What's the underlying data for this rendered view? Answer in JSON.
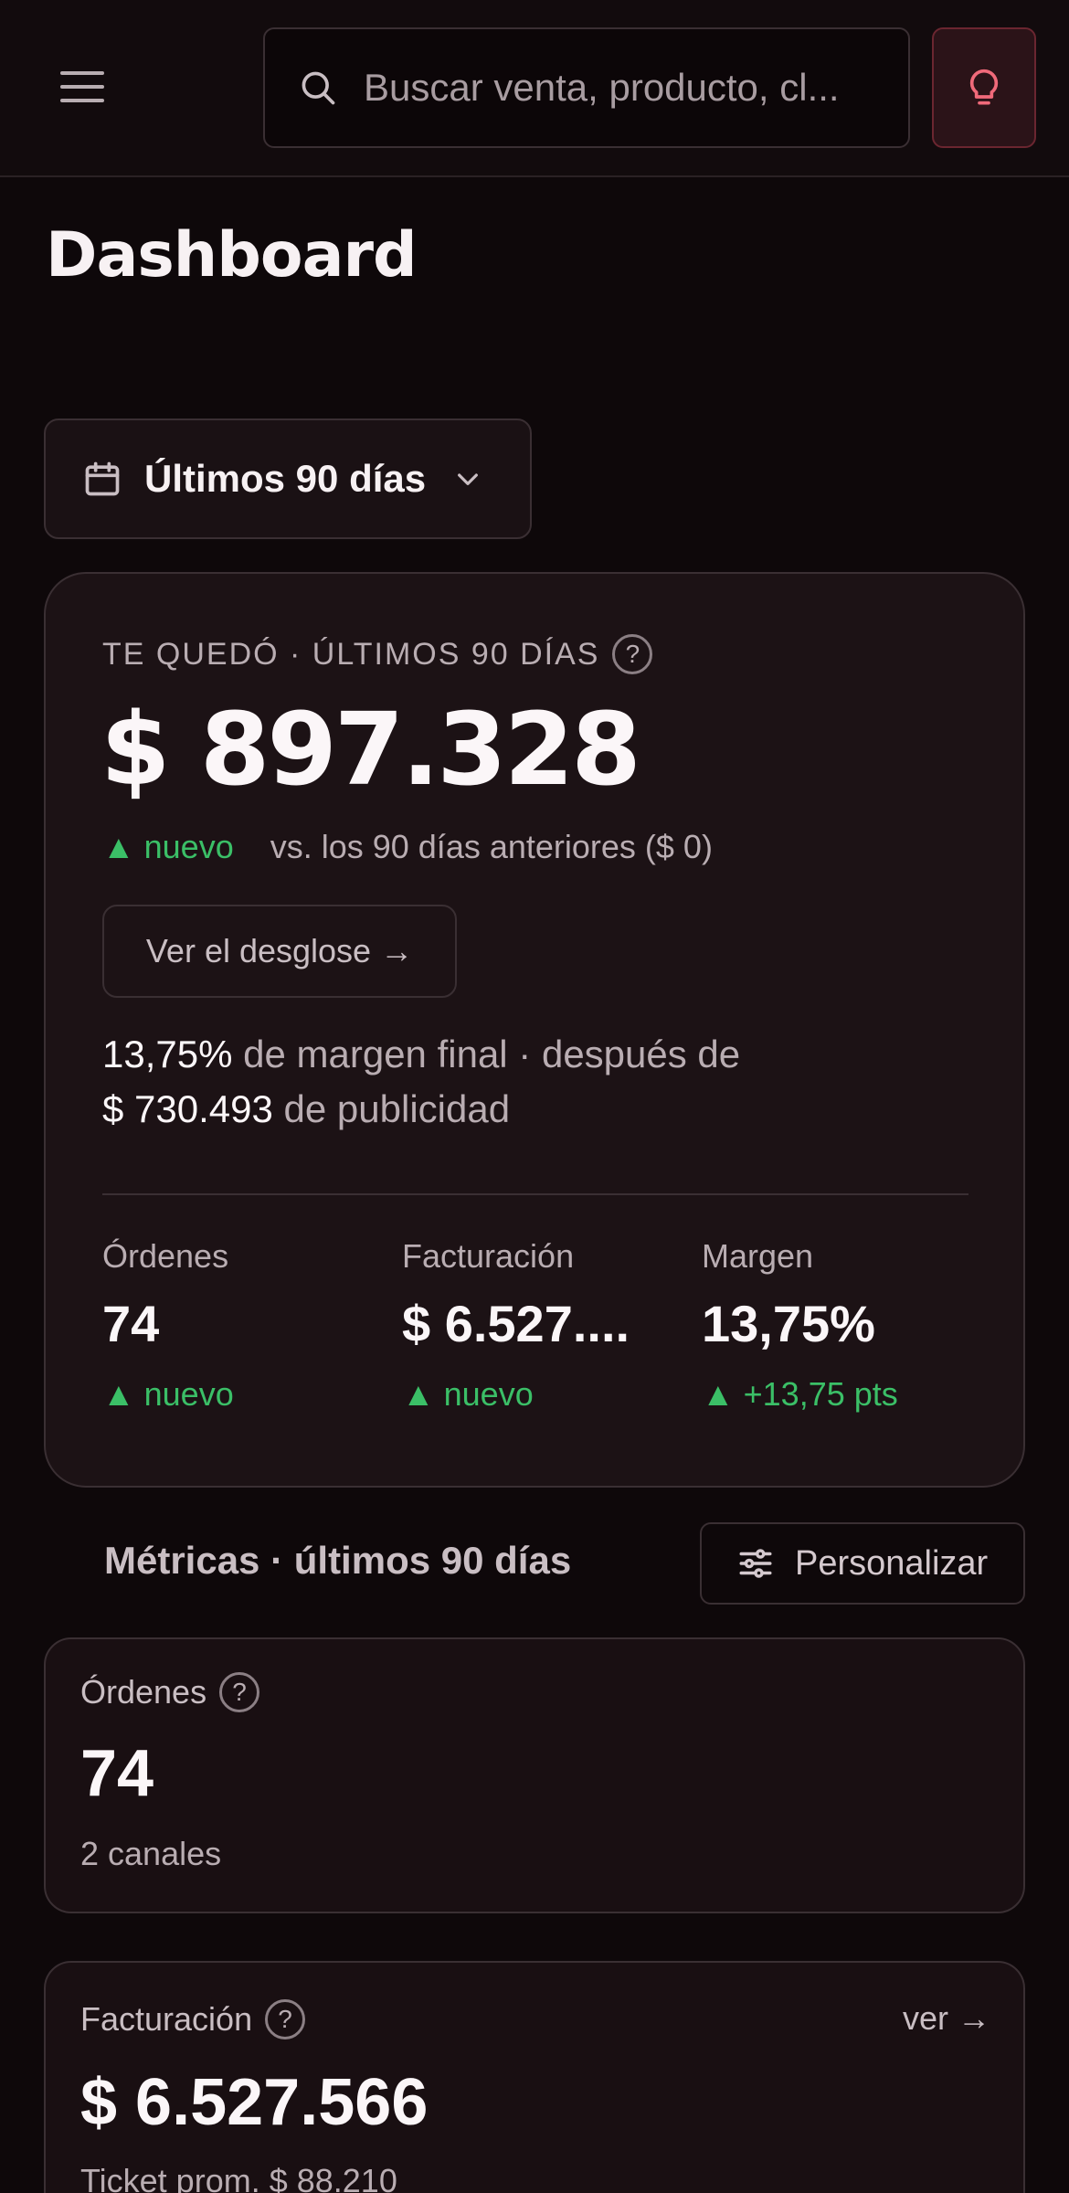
{
  "header": {
    "search_placeholder": "Buscar venta, producto, cl..."
  },
  "page_title": "Dashboard",
  "date_range": {
    "label": "Últimos 90 días"
  },
  "hero": {
    "eyebrow": "TE QUEDÓ · ÚLTIMOS 90 DÍAS",
    "help": "?",
    "value": "$ 897.328",
    "delta": "▲ nuevo",
    "compare": "vs. los 90 días anteriores ($ 0)",
    "breakdown_button": "Ver el desglose →",
    "margin_value": "13,75%",
    "margin_text": "de margen final · después de",
    "ads_value": "$ 730.493",
    "ads_text": "de publicidad",
    "kpis": [
      {
        "label": "Órdenes",
        "value": "74",
        "delta": "▲ nuevo"
      },
      {
        "label": "Facturación",
        "value": "$ 6.527....",
        "delta": "▲ nuevo"
      },
      {
        "label": "Margen",
        "value": "13,75%",
        "delta": "▲ +13,75 pts"
      }
    ]
  },
  "metrics_section": {
    "title": "Métricas · últimos 90 días",
    "customize_button": "Personalizar"
  },
  "metric_cards": [
    {
      "label": "Órdenes",
      "help": "?",
      "value": "74",
      "sub": "2 canales"
    },
    {
      "label": "Facturación",
      "help": "?",
      "value": "$ 6.527.566",
      "sub": "Ticket prom. $ 88.210",
      "link": "ver →"
    }
  ],
  "colors": {
    "background": "#0e080a",
    "card": "#1c1215",
    "positive": "#3bbf67",
    "accent": "#e05a6a"
  },
  "icons": [
    "menu-icon",
    "search-icon",
    "lightbulb-icon",
    "calendar-icon",
    "chevron-down-icon",
    "help-icon",
    "sliders-icon"
  ]
}
